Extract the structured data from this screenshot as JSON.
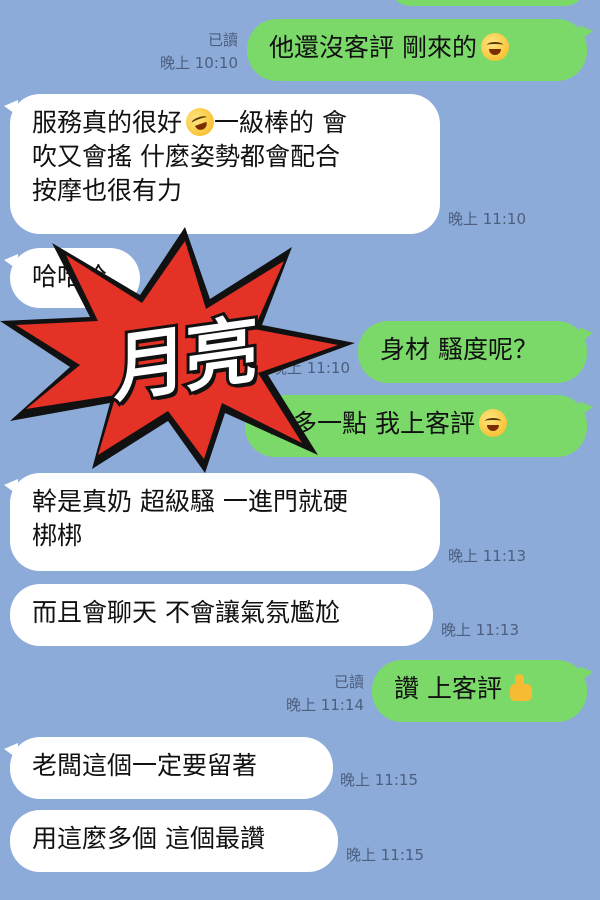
{
  "messages": [
    {
      "text": "他還沒客評 剛來的",
      "status": "已讀",
      "time": "晚上 10:10",
      "emoji": "laughing-tears-emoji"
    },
    {
      "text": "服務真的很好",
      "emoji": "rofl-emoji",
      "text2": "一級棒的 會",
      "line2": "吹又會搖 什麼姿勢都會配合",
      "line3": "按摩也很有力",
      "time": "晚上 11:10"
    },
    {
      "text": "哈哈哈"
    },
    {
      "text": "身材 騷度呢？",
      "time": "晚上 11:10"
    },
    {
      "text": "再多一點 我上客評",
      "emoji": "laughing-tears-emoji"
    },
    {
      "text": "幹是真奶 超級騷 一進門就硬",
      "line2": "梆梆",
      "time": "晚上 11:13"
    },
    {
      "text": "而且會聊天 不會讓氣氛尷尬",
      "time": "晚上 11:13"
    },
    {
      "text": "讚 上客評",
      "status": "已讀",
      "time": "晚上 11:14",
      "emoji": "thumbs-up-emoji"
    },
    {
      "text": "老闆這個一定要留著",
      "time": "晚上 11:15"
    },
    {
      "text": "用這麼多個 這個最讚",
      "time": "晚上 11:15"
    }
  ],
  "overlay": {
    "label": "月亮",
    "colors": {
      "burst": "#e53226",
      "outline": "#111111",
      "text": "#ffffff"
    }
  },
  "colors": {
    "background": "#8cabd9",
    "incoming": "#ffffff",
    "outgoing": "#7bd96a",
    "meta": "#4c5f7f"
  }
}
